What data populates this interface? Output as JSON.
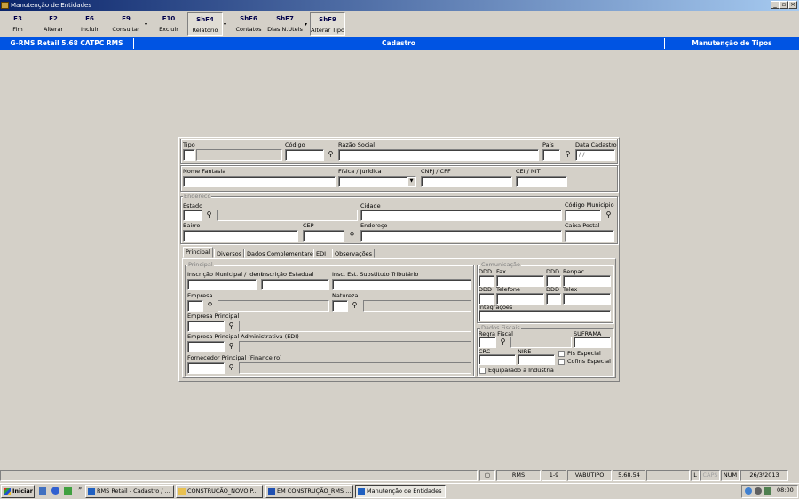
{
  "window": {
    "title": "Manutenção de Entidades"
  },
  "toolbar": [
    {
      "key": "F3",
      "label": "Fim"
    },
    {
      "key": "F2",
      "label": "Alterar"
    },
    {
      "key": "F6",
      "label": "Incluir"
    },
    {
      "key": "F9",
      "label": "Consultar"
    },
    {
      "key": "F10",
      "label": "Excluir"
    },
    {
      "key": "ShF4",
      "label": "Relatório"
    },
    {
      "key": "ShF6",
      "label": "Contatos"
    },
    {
      "key": "ShF7",
      "label": "Dias N.Uteis"
    },
    {
      "key": "ShF9",
      "label": "Alterar Tipo"
    }
  ],
  "bluebar": {
    "app": "G-RMS Retail 5.68 CATPC RMS",
    "module": "Cadastro",
    "screen": "Manutenção de Tipos"
  },
  "form": {
    "tipo": "Tipo",
    "codigo": "Código",
    "razao": "Razão Social",
    "pais": "País",
    "data_cadastro": "Data Cadastro",
    "data_value": " / /",
    "fantasia": "Nome Fantasia",
    "fisica": "Física / Jurídica",
    "cnpj": "CNPJ / CPF",
    "cei": "CEI / NIT",
    "endereco_group": "Endereco",
    "estado": "Estado",
    "cidade": "Cidade",
    "cod_municipio": "Código Municipio",
    "bairro": "Bairro",
    "cep": "CEP",
    "endereco": "Endereço",
    "caixa": "Caixa Postal"
  },
  "tabs": [
    "Principal",
    "Diversos",
    "Dados Complementares",
    "EDI",
    "Observações"
  ],
  "principal": {
    "group": "Principal",
    "insc_mun": "Inscrição Municipal / Ident",
    "insc_est": "Inscrição Estadual",
    "insc_sub": "Insc. Est. Substituto Tributário",
    "empresa": "Empresa",
    "natureza": "Natureza",
    "emp_principal": "Empresa Principal",
    "emp_adm": "Empresa Principal Administrativa (EDI)",
    "fornecedor": "Fornecedor Principal (Financeiro)"
  },
  "comunicacao": {
    "group": "Comunicação",
    "ddd1": "DDD",
    "fax": "Fax",
    "ddd2": "DDD",
    "renpac": "Renpac",
    "ddd3": "DDD",
    "telefone": "Telefone",
    "ddd4": "DDD",
    "telex": "Telex",
    "integracoes": "Integrações"
  },
  "fiscais": {
    "group": "Dados Fiscais",
    "regra": "Regra Fiscal",
    "suframa": "SUFRAMA",
    "crc": "CRC",
    "nire": "NIRE",
    "pis": "Pis Especial",
    "cofins": "Cofins Especial",
    "equiparado": "Equiparado a Indústria"
  },
  "statusbar": [
    "RMS",
    "1-9",
    "VABUTIPO",
    "5.68.54",
    "L",
    "CAPS",
    "NUM",
    "26/3/2013"
  ],
  "taskbar": {
    "start": "Iniciar",
    "tasks": [
      "RMS Retail - Cadastro / ...",
      "CONSTRUÇÃO_NOVO P...",
      "EM CONSTRUÇÃO_RMS ...",
      "Manutenção de Entidades"
    ],
    "clock": "08:00"
  },
  "colors": {
    "accent": "#0054e3",
    "title_start": "#0a246a",
    "face": "#d4d0c8"
  }
}
